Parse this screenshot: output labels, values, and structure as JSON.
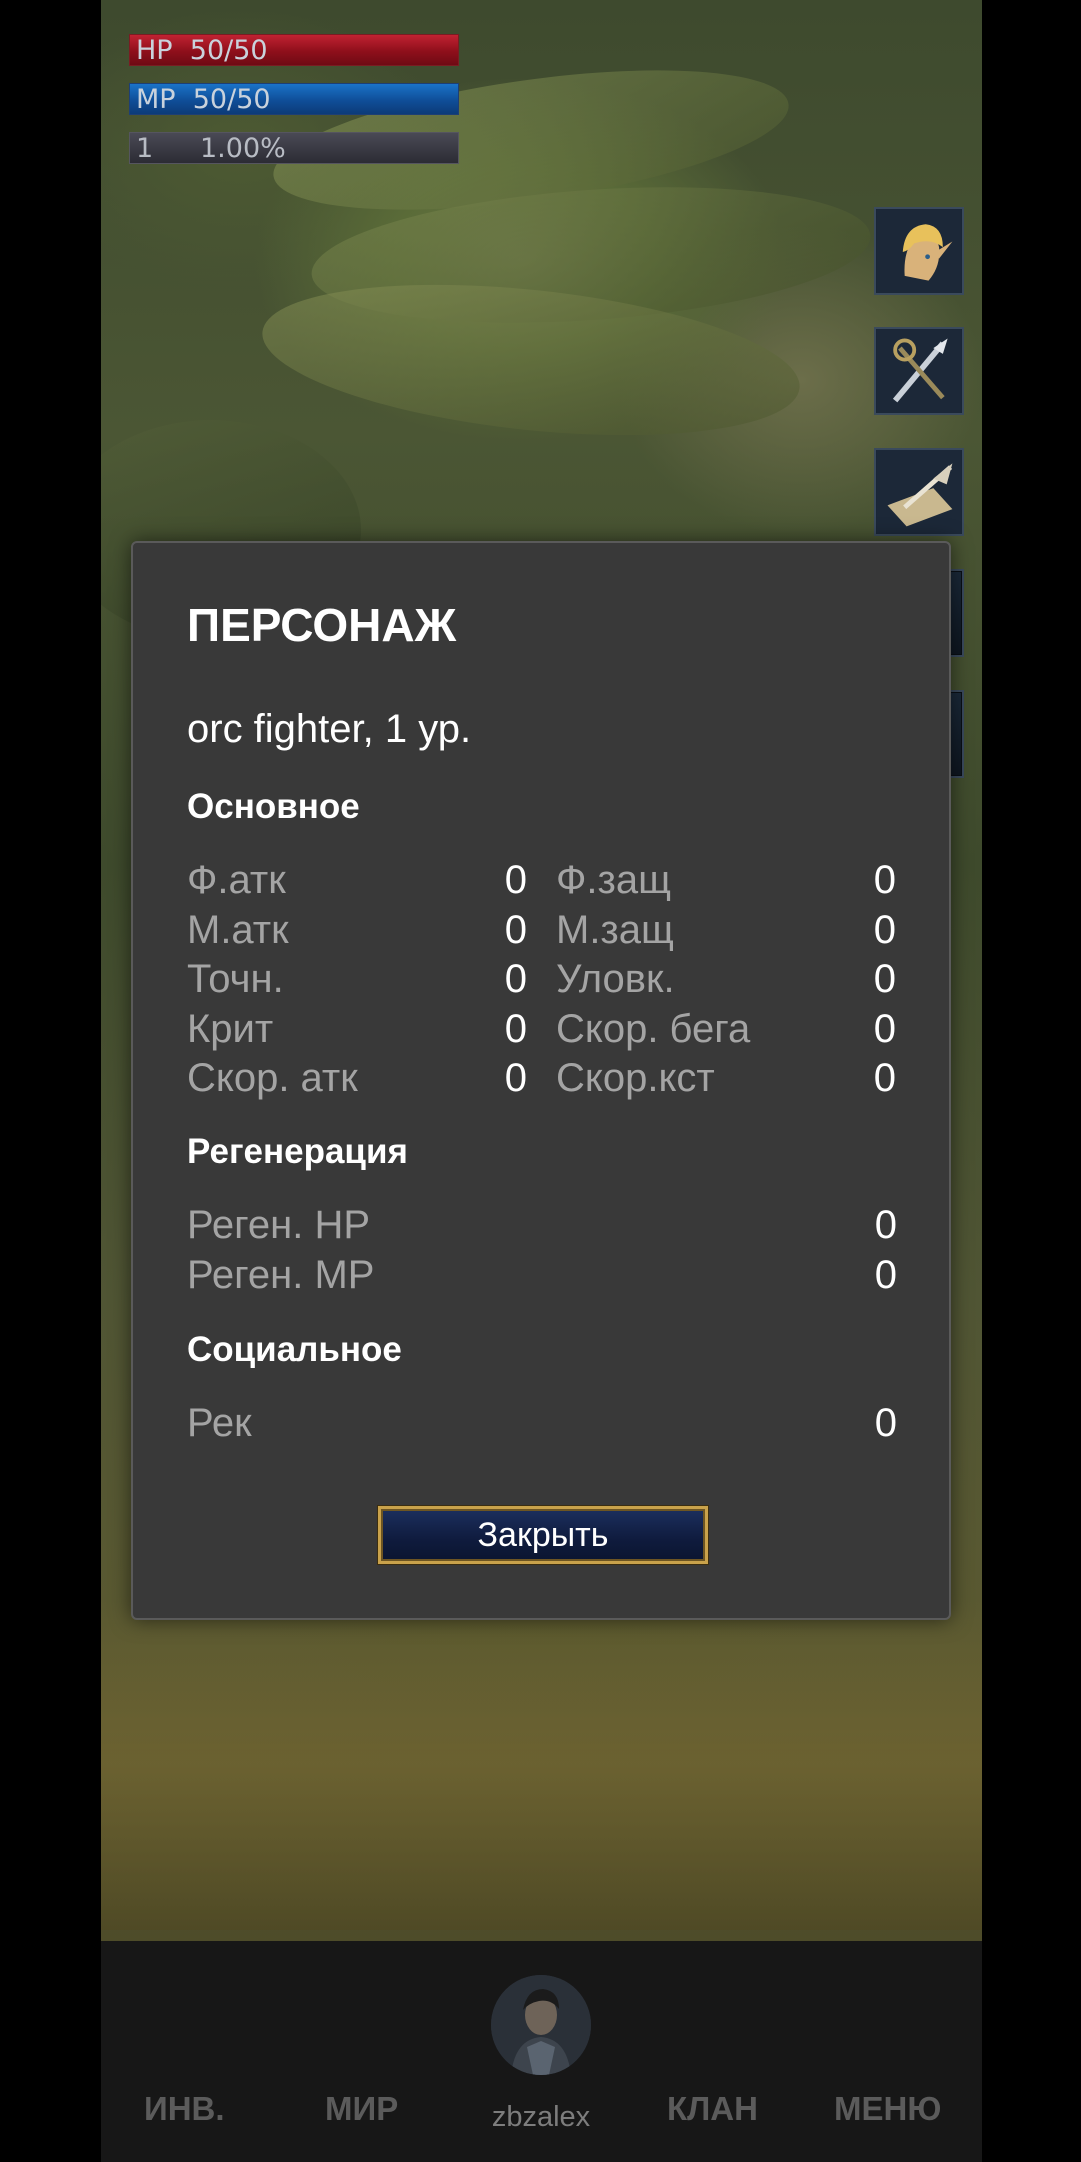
{
  "hud": {
    "hp": {
      "label": "HP",
      "value": "50/50",
      "fill_fraction": 1.0,
      "color": "#c12232"
    },
    "mp": {
      "label": "MP",
      "value": "50/50",
      "fill_fraction": 1.0,
      "color": "#1a73c8"
    },
    "xp": {
      "level": "1",
      "percent": "1.00%"
    }
  },
  "side_icons": [
    "elf-portrait-icon",
    "weapons-icon",
    "scroll-quill-icon",
    "panel-icon",
    "panel-icon"
  ],
  "modal": {
    "title": "ПЕРСОНАЖ",
    "character_line": "orc fighter, 1 ур.",
    "sections": {
      "main": {
        "title": "Основное",
        "rows": [
          {
            "left_label": "Ф.атк",
            "left_value": "0",
            "right_label": "Ф.защ",
            "right_value": "0"
          },
          {
            "left_label": "М.атк",
            "left_value": "0",
            "right_label": "М.защ",
            "right_value": "0"
          },
          {
            "left_label": "Точн.",
            "left_value": "0",
            "right_label": "Уловк.",
            "right_value": "0"
          },
          {
            "left_label": "Крит",
            "left_value": "0",
            "right_label": "Скор. бега",
            "right_value": "0"
          },
          {
            "left_label": "Скор. атк",
            "left_value": "0",
            "right_label": "Скор.кст",
            "right_value": "0"
          }
        ]
      },
      "regen": {
        "title": "Регенерация",
        "rows": [
          {
            "label": "Реген. HP",
            "value": "0"
          },
          {
            "label": "Реген. MP",
            "value": "0"
          }
        ]
      },
      "social": {
        "title": "Социальное",
        "rows": [
          {
            "label": "Рек",
            "value": "0"
          }
        ]
      }
    },
    "close_label": "Закрыть"
  },
  "nav": {
    "inventory": "ИНВ.",
    "world": "МИР",
    "username": "zbzalex",
    "clan": "КЛАН",
    "menu": "МЕНЮ"
  }
}
